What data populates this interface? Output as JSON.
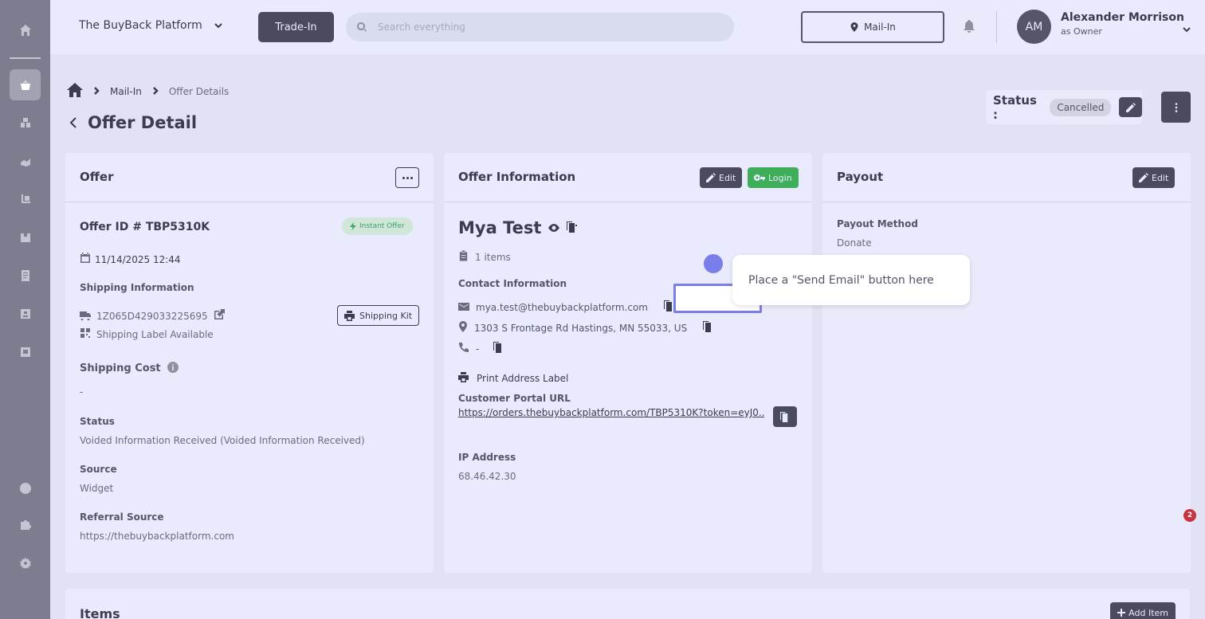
{
  "sidebar": {
    "icons": [
      "home-icon",
      "shop-icon",
      "boxes-icon",
      "hand-icon",
      "dolly-icon",
      "box-icon",
      "receipt-icon",
      "id-card-icon",
      "badge-icon",
      "help-icon",
      "puzzle-icon",
      "gear-icon"
    ]
  },
  "topbar": {
    "brand": "The BuyBack Platform",
    "trade_in": "Trade-In",
    "search_placeholder": "Search everything",
    "location": "Mail-In",
    "user": {
      "initials": "AM",
      "name": "Alexander Morrison",
      "role": "as Owner"
    }
  },
  "breadcrumb": {
    "level1": "Mail-In",
    "level2": "Offer Details"
  },
  "page_title": "Offer Detail",
  "status": {
    "label": "Status :",
    "value": "Cancelled"
  },
  "offer_card": {
    "title": "Offer",
    "offer_id": "Offer ID # TBP5310K",
    "instant_badge": "Instant Offer",
    "date": "11/14/2025 12:44",
    "shipping_info_label": "Shipping Information",
    "tracking": "1Z065D429033225695",
    "shipping_kit": "Shipping Kit",
    "shipping_label": "Shipping Label Available",
    "shipping_cost_label": "Shipping Cost",
    "shipping_cost": "-",
    "status_label": "Status",
    "status_value": "Voided Information Received (Voided Information Received)",
    "source_label": "Source",
    "source_value": "Widget",
    "referral_label": "Referral Source",
    "referral_value": "https://thebuybackplatform.com"
  },
  "offer_info_card": {
    "title": "Offer Information",
    "edit": "Edit",
    "login": "Login",
    "customer_name": "Mya Test",
    "items_count": "1 items",
    "contact_label": "Contact Information",
    "email": "mya.test@thebuybackplatform.com",
    "address": "1303 S Frontage Rd Hastings, MN 55033, US",
    "phone": "-",
    "print_label": "Print Address Label",
    "portal_label": "Customer Portal URL",
    "portal_url": "https://orders.thebuybackplatform.com/TBP5310K?token=eyJ0...",
    "ip_label": "IP Address",
    "ip_value": "68.46.42.30"
  },
  "payout_card": {
    "title": "Payout",
    "edit": "Edit",
    "method_label": "Payout Method",
    "method_value": "Donate"
  },
  "tooltip": "Place a \"Send Email\" button here",
  "notification_count": "2",
  "items_card": {
    "title": "Items",
    "add_item": "Add Item"
  },
  "colors": {
    "sidebar": "#7c7d8e",
    "dark_button": "#4a4b5f",
    "login_green": "#3fae5a",
    "highlight": "#7a7ee8",
    "badge_red": "#c9323f"
  }
}
